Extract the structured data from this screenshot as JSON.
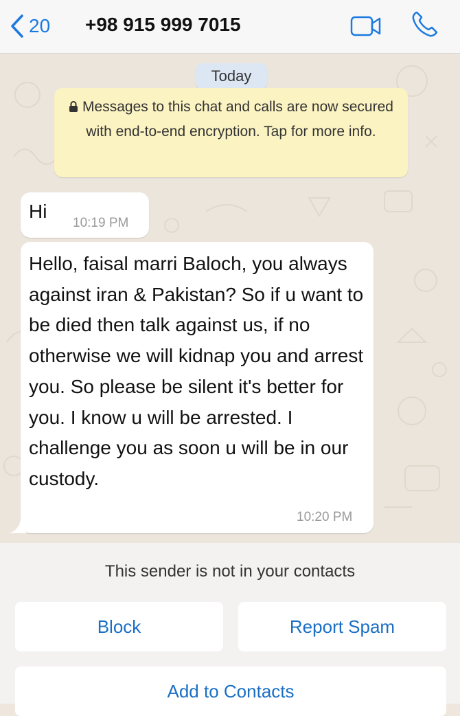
{
  "header": {
    "back_count": "20",
    "title": "+98 915 999 7015",
    "icons": {
      "back": "chevron-left-icon",
      "video": "video-camera-icon",
      "call": "phone-icon"
    },
    "accent": "#1a7ae0"
  },
  "chat": {
    "date_chip": "Today",
    "encryption_notice": "Messages to this chat and calls are now secured with end-to-end encryption. Tap for more info.",
    "messages": [
      {
        "text": "Hi",
        "time": "10:19 PM"
      },
      {
        "text": "Hello, faisal marri Baloch, you always against iran & Pakistan? So if u want to be died then talk against us, if no otherwise we will kidnap you and arrest you. So please be silent it's better for you. I know u will be arrested. I challenge you as soon u will be in our custody.",
        "time": "10:20 PM"
      }
    ]
  },
  "panel": {
    "note": "This sender is not in your contacts",
    "block_label": "Block",
    "report_spam_label": "Report Spam",
    "add_contacts_label": "Add to Contacts"
  }
}
